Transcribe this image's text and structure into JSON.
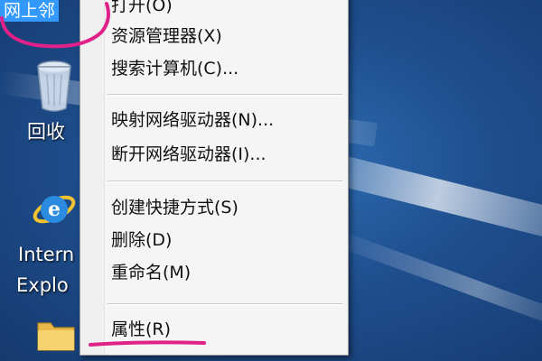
{
  "desktop": {
    "selected_icon_label": "网上邻",
    "recycle_label": "回收",
    "ie_label_line1": "Intern",
    "ie_label_line2": "Explo"
  },
  "context_menu": {
    "items": [
      {
        "label": "打开(O)"
      },
      {
        "label": "资源管理器(X)"
      },
      {
        "label": "搜索计算机(C)..."
      },
      {
        "label": "映射网络驱动器(N)..."
      },
      {
        "label": "断开网络驱动器(I)..."
      },
      {
        "label": "创建快捷方式(S)"
      },
      {
        "label": "删除(D)"
      },
      {
        "label": "重命名(M)"
      },
      {
        "label": "属性(R)"
      }
    ]
  },
  "colors": {
    "annotation": "#e0218a",
    "selection": "#3399ff",
    "menu_bg": "#f5f5f5"
  }
}
